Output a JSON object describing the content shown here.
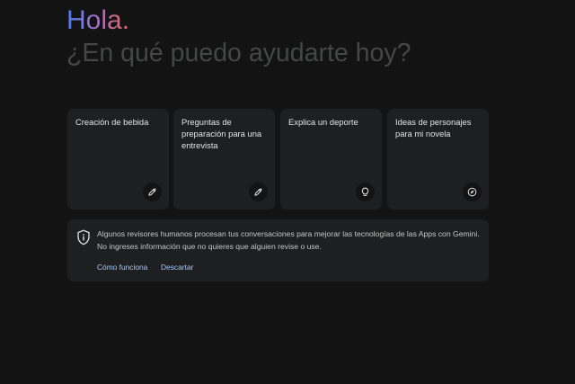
{
  "greeting": "Hola.",
  "subtitle": "¿En qué puedo ayudarte hoy?",
  "cards": [
    {
      "label": "Creación de bebida",
      "icon": "edit-pencil-icon"
    },
    {
      "label": "Preguntas de preparación para una entrevista",
      "icon": "edit-pencil-icon"
    },
    {
      "label": "Explica un deporte",
      "icon": "lightbulb-icon"
    },
    {
      "label": "Ideas de personajes para mi novela",
      "icon": "compass-icon"
    }
  ],
  "notice": {
    "icon": "shield-icon",
    "text": "Algunos revisores humanos procesan tus conversaciones para mejorar las tecnologías de las Apps con Gemini. No ingreses información que no quieres que alguien revise o use.",
    "link_how": "Cómo funciona",
    "link_dismiss": "Descartar"
  },
  "colors": {
    "background": "#131314",
    "card": "#1e1f20",
    "text": "#e3e3e3",
    "muted": "#444746",
    "link": "#a8c7fa"
  }
}
